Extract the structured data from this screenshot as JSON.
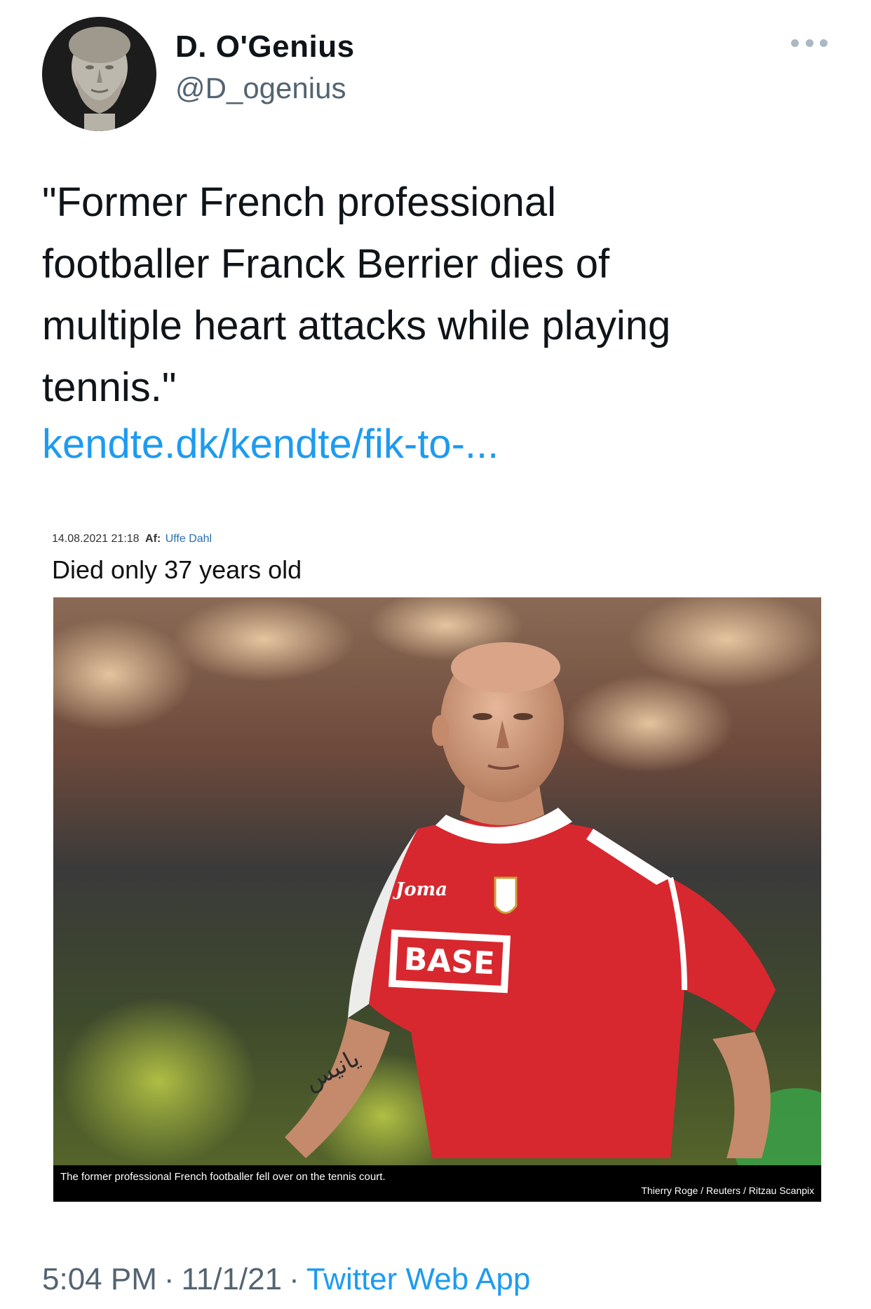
{
  "author": {
    "display_name": "D. O'Genius",
    "handle": "@D_ogenius",
    "avatar_icon": "bust-sculpture-avatar"
  },
  "tweet": {
    "text": "\"Former French professional\nfootballer Franck Berrier dies of\nmultiple heart attacks while playing\ntennis.\"",
    "link_text": "kendte.dk/kendte/fik-to-..."
  },
  "article": {
    "date": "14.08.2021 21:18",
    "author_label": "Af:",
    "author_name": "Uffe Dahl",
    "headline": "Died only 37 years old",
    "photo": {
      "caption": "The former professional French footballer fell over on the tennis court.",
      "credit": "Thierry Roge / Reuters / Ritzau Scanpix",
      "jersey_brand": "Joma",
      "jersey_sponsor": "BASE",
      "tattoo_text": "يانيس"
    }
  },
  "footer": {
    "time": "5:04 PM",
    "date": "11/1/21",
    "source": "Twitter Web App",
    "separator": "·"
  },
  "colors": {
    "link": "#1d9bf0",
    "secondary_text": "#536471",
    "jersey_red": "#d8282f"
  }
}
